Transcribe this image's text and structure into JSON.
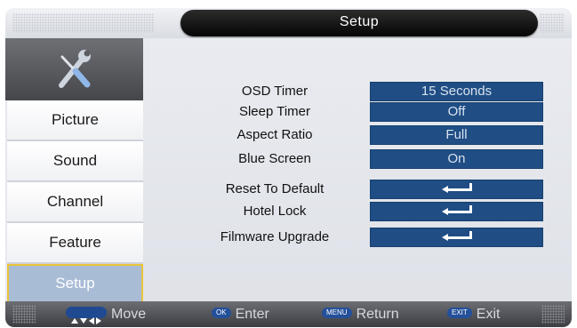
{
  "header": {
    "title": "Setup"
  },
  "sidebar": {
    "icon": "tools-icon",
    "items": [
      {
        "label": "Picture"
      },
      {
        "label": "Sound"
      },
      {
        "label": "Channel"
      },
      {
        "label": "Feature"
      },
      {
        "label": "Setup",
        "active": true
      }
    ]
  },
  "settings": [
    {
      "label": "OSD Timer",
      "value": "15 Seconds"
    },
    {
      "label": "Sleep Timer",
      "value": "Off"
    },
    {
      "label": "Aspect Ratio",
      "value": "Full"
    },
    {
      "label": "Blue Screen",
      "value": "On"
    },
    {
      "label": "Reset To Default",
      "value_icon": "enter-arrow-icon"
    },
    {
      "label": "Hotel Lock",
      "value_icon": "enter-arrow-icon"
    },
    {
      "label": "Filmware Upgrade",
      "value_icon": "enter-arrow-icon"
    }
  ],
  "footer": {
    "move": {
      "key_icon": "arrow-keys-icon",
      "label": "Move"
    },
    "enter": {
      "key": "OK",
      "label": "Enter"
    },
    "return": {
      "key": "MENU",
      "label": "Return"
    },
    "exit": {
      "key": "EXIT",
      "label": "Exit"
    }
  },
  "colors": {
    "value_box": "#1f4d84",
    "active_menu": "#a9bcd6",
    "active_border": "#e9c43a",
    "title_bar": "#050505"
  }
}
